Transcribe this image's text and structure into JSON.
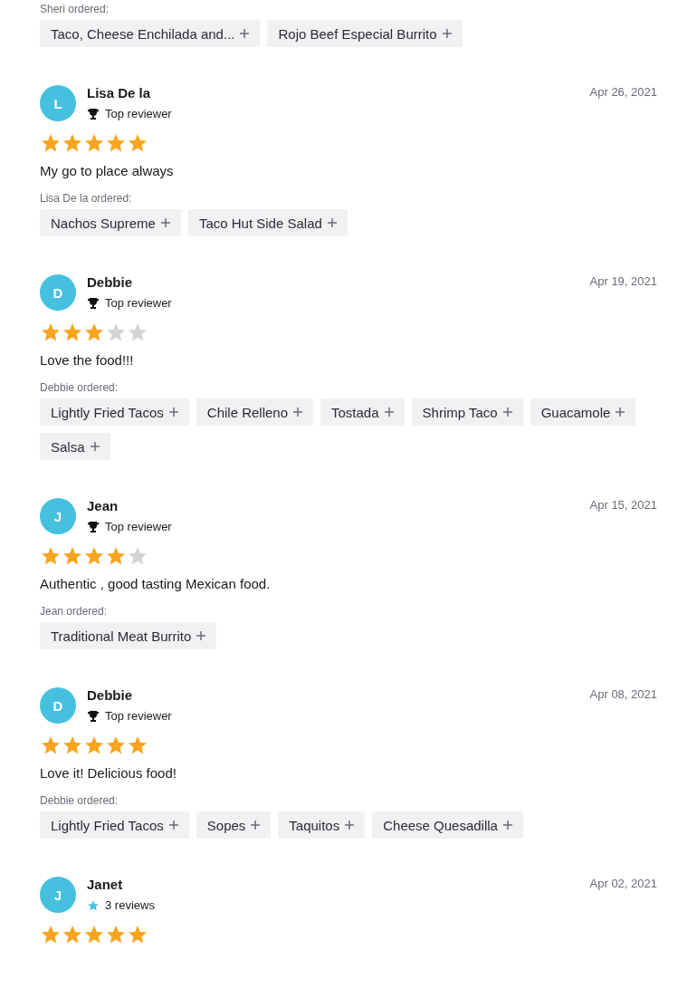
{
  "top_order": {
    "label": "Sheri ordered:",
    "items": [
      "Taco, Cheese Enchilada and...",
      "Rojo Beef Especial Burrito"
    ]
  },
  "reviews": [
    {
      "initial": "L",
      "name": "Lisa De la",
      "badge": {
        "kind": "top",
        "text": "Top reviewer"
      },
      "date": "Apr 26, 2021",
      "stars": 5,
      "comment": "My go to place always",
      "ordered_label": "Lisa De la ordered:",
      "items": [
        "Nachos Supreme",
        "Taco Hut Side Salad"
      ]
    },
    {
      "initial": "D",
      "name": "Debbie",
      "badge": {
        "kind": "top",
        "text": "Top reviewer"
      },
      "date": "Apr 19, 2021",
      "stars": 3,
      "comment": "Love the food!!!",
      "ordered_label": "Debbie ordered:",
      "items": [
        "Lightly Fried Tacos",
        "Chile Relleno",
        "Tostada",
        "Shrimp Taco",
        "Guacamole",
        "Salsa"
      ]
    },
    {
      "initial": "J",
      "name": "Jean",
      "badge": {
        "kind": "top",
        "text": "Top reviewer"
      },
      "date": "Apr 15, 2021",
      "stars": 4,
      "comment": "Authentic , good tasting Mexican food.",
      "ordered_label": "Jean ordered:",
      "items": [
        "Traditional Meat Burrito"
      ]
    },
    {
      "initial": "D",
      "name": "Debbie",
      "badge": {
        "kind": "top",
        "text": "Top reviewer"
      },
      "date": "Apr 08, 2021",
      "stars": 5,
      "comment": "Love it! Delicious food!",
      "ordered_label": "Debbie ordered:",
      "items": [
        "Lightly Fried Tacos",
        "Sopes",
        "Taquitos",
        "Cheese Quesadilla"
      ]
    },
    {
      "initial": "J",
      "name": "Janet",
      "badge": {
        "kind": "count",
        "text": "3 reviews"
      },
      "date": "Apr 02, 2021",
      "stars": 5
    }
  ]
}
